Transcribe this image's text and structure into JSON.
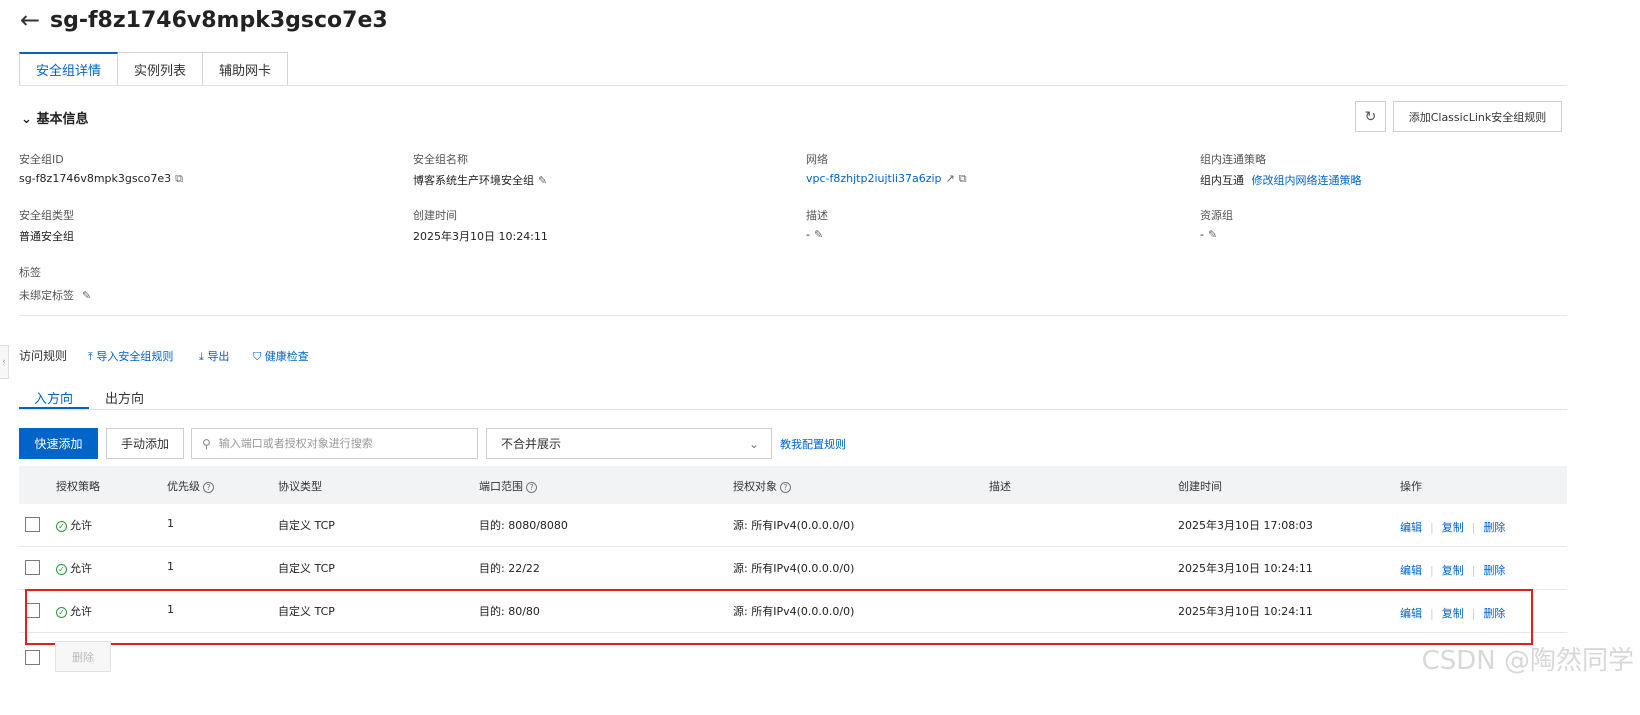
{
  "header": {
    "back_icon": "arrow-left-icon",
    "title": "sg-f8z1746v8mpk3gsco7e3"
  },
  "tabs": [
    {
      "label": "安全组详情",
      "active": true
    },
    {
      "label": "实例列表",
      "active": false
    },
    {
      "label": "辅助网卡",
      "active": false
    }
  ],
  "basic_info": {
    "title": "基本信息",
    "refresh_icon": "refresh-icon",
    "classiclink_button": "添加ClassicLink安全组规则",
    "fields": {
      "sg_id": {
        "label": "安全组ID",
        "value": "sg-f8z1746v8mpk3gsco7e3"
      },
      "sg_name": {
        "label": "安全组名称",
        "value": "博客系统生产环境安全组"
      },
      "network": {
        "label": "网络",
        "value": "vpc-f8zhjtp2iujtli37a6zip"
      },
      "policy": {
        "label": "组内连通策略",
        "value": "组内互通",
        "link": "修改组内网络连通策略"
      },
      "sg_type": {
        "label": "安全组类型",
        "value": "普通安全组"
      },
      "created": {
        "label": "创建时间",
        "value": "2025年3月10日 10:24:11"
      },
      "desc": {
        "label": "描述",
        "value": "-"
      },
      "resource_group": {
        "label": "资源组",
        "value": "-"
      },
      "tags": {
        "label": "标签",
        "value": "未绑定标签"
      }
    }
  },
  "rules_toolbar": {
    "label": "访问规则",
    "import": "导入安全组规则",
    "export": "导出",
    "health": "健康检查"
  },
  "direction_tabs": [
    {
      "label": "入方向",
      "active": true
    },
    {
      "label": "出方向",
      "active": false
    }
  ],
  "controls": {
    "quick_add": "快速添加",
    "manual_add": "手动添加",
    "search_placeholder": "输入端口或者授权对象进行搜索",
    "select_value": "不合并展示",
    "teach_link": "教我配置规则"
  },
  "table": {
    "columns": {
      "policy": "授权策略",
      "priority": "优先级",
      "protocol": "协议类型",
      "port": "端口范围",
      "target": "授权对象",
      "desc": "描述",
      "created": "创建时间",
      "ops": "操作"
    },
    "rows": [
      {
        "policy": "允许",
        "priority": "1",
        "protocol": "自定义 TCP",
        "port": "目的: 8080/8080",
        "target": "源: 所有IPv4(0.0.0.0/0)",
        "desc": "",
        "created": "2025年3月10日 17:08:03",
        "edit": "编辑",
        "copy": "复制",
        "delete": "删除"
      },
      {
        "policy": "允许",
        "priority": "1",
        "protocol": "自定义 TCP",
        "port": "目的: 22/22",
        "target": "源: 所有IPv4(0.0.0.0/0)",
        "desc": "",
        "created": "2025年3月10日 10:24:11",
        "edit": "编辑",
        "copy": "复制",
        "delete": "删除"
      },
      {
        "policy": "允许",
        "priority": "1",
        "protocol": "自定义 TCP",
        "port": "目的: 80/80",
        "target": "源: 所有IPv4(0.0.0.0/0)",
        "desc": "",
        "created": "2025年3月10日 10:24:11",
        "edit": "编辑",
        "copy": "复制",
        "delete": "删除"
      }
    ],
    "bulk_delete": "删除"
  },
  "watermark": "CSDN @陶然同学",
  "colors": {
    "accent": "#0064c8",
    "highlight": "#e02020",
    "allow": "#2a9a3a"
  }
}
